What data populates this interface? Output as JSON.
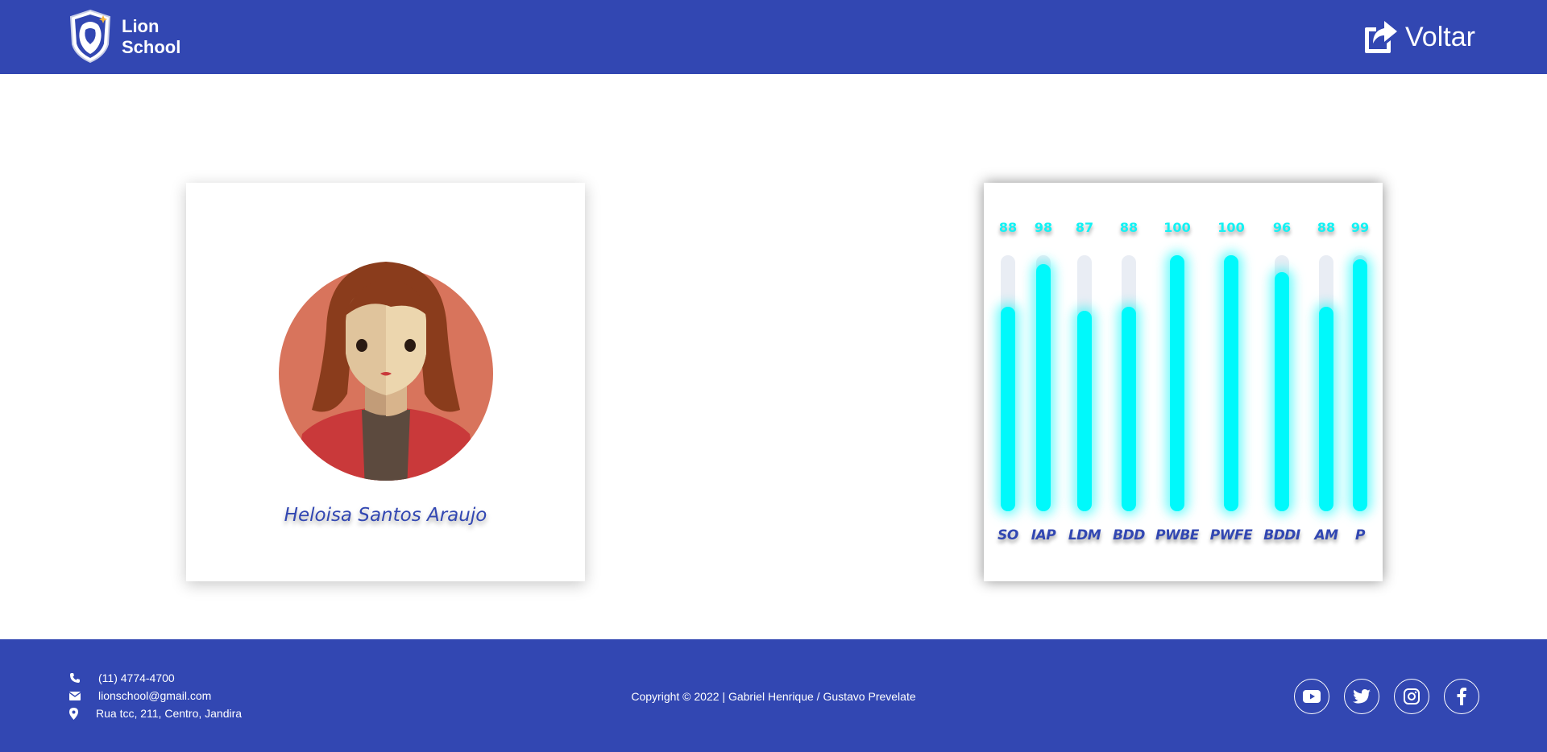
{
  "header": {
    "brand_line1": "Lion",
    "brand_line2": "School",
    "back_label": "Voltar"
  },
  "student": {
    "name": "Heloisa Santos Araujo",
    "avatar_icon": "female-avatar-icon"
  },
  "chart_data": {
    "type": "bar",
    "categories": [
      "SO",
      "IAP",
      "LDM",
      "BDD",
      "PWBE",
      "PWFE",
      "BDDI",
      "AM",
      "P"
    ],
    "values": [
      88,
      98,
      87,
      88,
      100,
      100,
      96,
      88,
      99
    ],
    "ylim": [
      0,
      100
    ],
    "xlabel": "",
    "ylabel": "",
    "grid": false,
    "bar_color": "#00f9fb",
    "label_color": "#3247b2"
  },
  "footer": {
    "phone": "(11) 4774-4700",
    "email": "lionschool@gmail.com",
    "address": "Rua tcc, 211, Centro, Jandira",
    "copyright": "Copyright © 2022 | Gabriel Henrique / Gustavo Prevelate",
    "socials": [
      "youtube-icon",
      "twitter-icon",
      "instagram-icon",
      "facebook-icon"
    ]
  },
  "colors": {
    "primary": "#3247b2",
    "accent": "#00f9fb"
  }
}
